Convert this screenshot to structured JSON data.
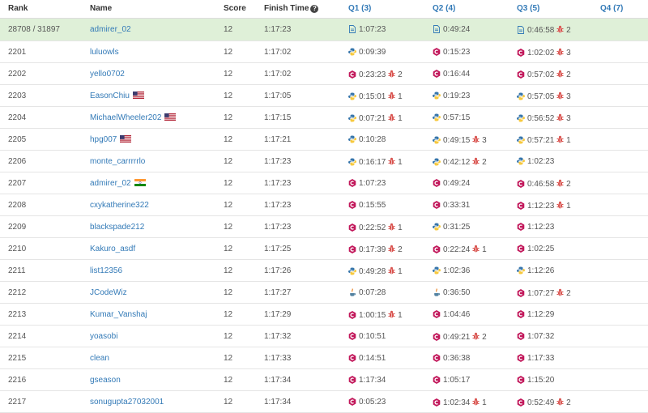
{
  "header": {
    "rank": "Rank",
    "name": "Name",
    "score": "Score",
    "finish_time": "Finish Time",
    "q1": "Q1 (3)",
    "q2": "Q2 (4)",
    "q3": "Q3 (5)",
    "q4": "Q4 (7)"
  },
  "rows": [
    {
      "rank": "28708 / 31897",
      "name": "admirer_02",
      "flag": "",
      "score": "12",
      "time": "1:17:23",
      "highlight": true,
      "q1": {
        "t": "1:07:23",
        "lang": "doc",
        "b": ""
      },
      "q2": {
        "t": "0:49:24",
        "lang": "doc",
        "b": ""
      },
      "q3": {
        "t": "0:46:58",
        "lang": "doc",
        "b": "2"
      }
    },
    {
      "rank": "2201",
      "name": "luluowls",
      "flag": "",
      "score": "12",
      "time": "1:17:02",
      "q1": {
        "t": "0:09:39",
        "lang": "python",
        "b": ""
      },
      "q2": {
        "t": "0:15:23",
        "lang": "cpp",
        "b": ""
      },
      "q3": {
        "t": "1:02:02",
        "lang": "cpp",
        "b": "3"
      }
    },
    {
      "rank": "2202",
      "name": "yello0702",
      "flag": "",
      "score": "12",
      "time": "1:17:02",
      "q1": {
        "t": "0:23:23",
        "lang": "cpp",
        "b": "2"
      },
      "q2": {
        "t": "0:16:44",
        "lang": "cpp",
        "b": ""
      },
      "q3": {
        "t": "0:57:02",
        "lang": "cpp",
        "b": "2"
      }
    },
    {
      "rank": "2203",
      "name": "EasonChiu",
      "flag": "us",
      "score": "12",
      "time": "1:17:05",
      "q1": {
        "t": "0:15:01",
        "lang": "python",
        "b": "1"
      },
      "q2": {
        "t": "0:19:23",
        "lang": "python",
        "b": ""
      },
      "q3": {
        "t": "0:57:05",
        "lang": "python",
        "b": "3"
      }
    },
    {
      "rank": "2204",
      "name": "MichaelWheeler202",
      "flag": "us",
      "score": "12",
      "time": "1:17:15",
      "q1": {
        "t": "0:07:21",
        "lang": "python",
        "b": "1"
      },
      "q2": {
        "t": "0:57:15",
        "lang": "python",
        "b": ""
      },
      "q3": {
        "t": "0:56:52",
        "lang": "python",
        "b": "3"
      }
    },
    {
      "rank": "2205",
      "name": "hpg007",
      "flag": "us",
      "score": "12",
      "time": "1:17:21",
      "q1": {
        "t": "0:10:28",
        "lang": "python",
        "b": ""
      },
      "q2": {
        "t": "0:49:15",
        "lang": "python",
        "b": "3"
      },
      "q3": {
        "t": "0:57:21",
        "lang": "python",
        "b": "1"
      }
    },
    {
      "rank": "2206",
      "name": "monte_carrrrrlo",
      "flag": "",
      "score": "12",
      "time": "1:17:23",
      "q1": {
        "t": "0:16:17",
        "lang": "python",
        "b": "1"
      },
      "q2": {
        "t": "0:42:12",
        "lang": "python",
        "b": "2"
      },
      "q3": {
        "t": "1:02:23",
        "lang": "python",
        "b": ""
      }
    },
    {
      "rank": "2207",
      "name": "admirer_02",
      "flag": "in",
      "score": "12",
      "time": "1:17:23",
      "q1": {
        "t": "1:07:23",
        "lang": "cpp",
        "b": ""
      },
      "q2": {
        "t": "0:49:24",
        "lang": "cpp",
        "b": ""
      },
      "q3": {
        "t": "0:46:58",
        "lang": "cpp",
        "b": "2"
      }
    },
    {
      "rank": "2208",
      "name": "cxykatherine322",
      "flag": "",
      "score": "12",
      "time": "1:17:23",
      "q1": {
        "t": "0:15:55",
        "lang": "cpp",
        "b": ""
      },
      "q2": {
        "t": "0:33:31",
        "lang": "cpp",
        "b": ""
      },
      "q3": {
        "t": "1:12:23",
        "lang": "cpp",
        "b": "1"
      }
    },
    {
      "rank": "2209",
      "name": "blackspade212",
      "flag": "",
      "score": "12",
      "time": "1:17:23",
      "q1": {
        "t": "0:22:52",
        "lang": "cpp",
        "b": "1"
      },
      "q2": {
        "t": "0:31:25",
        "lang": "python",
        "b": ""
      },
      "q3": {
        "t": "1:12:23",
        "lang": "cpp",
        "b": ""
      }
    },
    {
      "rank": "2210",
      "name": "Kakuro_asdf",
      "flag": "",
      "score": "12",
      "time": "1:17:25",
      "q1": {
        "t": "0:17:39",
        "lang": "cpp",
        "b": "2"
      },
      "q2": {
        "t": "0:22:24",
        "lang": "cpp",
        "b": "1"
      },
      "q3": {
        "t": "1:02:25",
        "lang": "cpp",
        "b": ""
      }
    },
    {
      "rank": "2211",
      "name": "list12356",
      "flag": "",
      "score": "12",
      "time": "1:17:26",
      "q1": {
        "t": "0:49:28",
        "lang": "python",
        "b": "1"
      },
      "q2": {
        "t": "1:02:36",
        "lang": "python",
        "b": ""
      },
      "q3": {
        "t": "1:12:26",
        "lang": "python",
        "b": ""
      }
    },
    {
      "rank": "2212",
      "name": "JCodeWiz",
      "flag": "",
      "score": "12",
      "time": "1:17:27",
      "q1": {
        "t": "0:07:28",
        "lang": "java",
        "b": ""
      },
      "q2": {
        "t": "0:36:50",
        "lang": "java",
        "b": ""
      },
      "q3": {
        "t": "1:07:27",
        "lang": "cpp",
        "b": "2"
      }
    },
    {
      "rank": "2213",
      "name": "Kumar_Vanshaj",
      "flag": "",
      "score": "12",
      "time": "1:17:29",
      "q1": {
        "t": "1:00:15",
        "lang": "cpp",
        "b": "1"
      },
      "q2": {
        "t": "1:04:46",
        "lang": "cpp",
        "b": ""
      },
      "q3": {
        "t": "1:12:29",
        "lang": "cpp",
        "b": ""
      }
    },
    {
      "rank": "2214",
      "name": "yoasobi",
      "flag": "",
      "score": "12",
      "time": "1:17:32",
      "q1": {
        "t": "0:10:51",
        "lang": "cpp",
        "b": ""
      },
      "q2": {
        "t": "0:49:21",
        "lang": "cpp",
        "b": "2"
      },
      "q3": {
        "t": "1:07:32",
        "lang": "cpp",
        "b": ""
      }
    },
    {
      "rank": "2215",
      "name": "clean",
      "flag": "",
      "score": "12",
      "time": "1:17:33",
      "q1": {
        "t": "0:14:51",
        "lang": "cpp",
        "b": ""
      },
      "q2": {
        "t": "0:36:38",
        "lang": "cpp",
        "b": ""
      },
      "q3": {
        "t": "1:17:33",
        "lang": "cpp",
        "b": ""
      }
    },
    {
      "rank": "2216",
      "name": "gseason",
      "flag": "",
      "score": "12",
      "time": "1:17:34",
      "q1": {
        "t": "1:17:34",
        "lang": "cpp",
        "b": ""
      },
      "q2": {
        "t": "1:05:17",
        "lang": "cpp",
        "b": ""
      },
      "q3": {
        "t": "1:15:20",
        "lang": "cpp",
        "b": ""
      }
    },
    {
      "rank": "2217",
      "name": "sonugupta27032001",
      "flag": "",
      "score": "12",
      "time": "1:17:34",
      "q1": {
        "t": "0:05:23",
        "lang": "cpp",
        "b": ""
      },
      "q2": {
        "t": "1:02:34",
        "lang": "cpp",
        "b": "1"
      },
      "q3": {
        "t": "0:52:49",
        "lang": "cpp",
        "b": "2"
      }
    }
  ],
  "colors": {
    "link": "#337ab7",
    "highlight": "#dff0d8",
    "bug": "#d9534f",
    "cpp": "#c2185b",
    "python_blue": "#3776ab",
    "python_yellow": "#f7c93e"
  }
}
